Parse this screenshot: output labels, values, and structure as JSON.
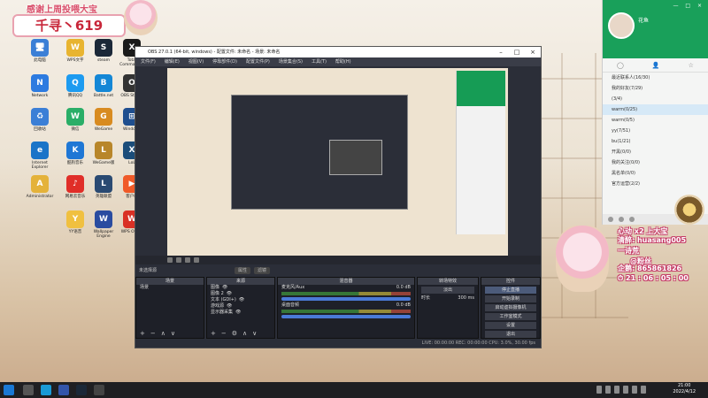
{
  "banner": {
    "title": "感谢上周投喂大宝",
    "name": "千寻丶619"
  },
  "desktop_icons": [
    {
      "label": "此电脑",
      "color": "#3b7fd6",
      "glyph": "🖥"
    },
    {
      "label": "WPS文字",
      "color": "#e8b430",
      "glyph": "W"
    },
    {
      "label": "steam",
      "color": "#1b2838",
      "glyph": "S"
    },
    {
      "label": "Total Commander",
      "color": "#1a1a1a",
      "glyph": "X"
    },
    {
      "label": "Network",
      "color": "#2d7be0",
      "glyph": "N"
    },
    {
      "label": "腾讯QQ",
      "color": "#1d9bf0",
      "glyph": "Q"
    },
    {
      "label": "Battle.net",
      "color": "#1487d6",
      "glyph": "B"
    },
    {
      "label": "OBS Studio",
      "color": "#333",
      "glyph": "O"
    },
    {
      "label": "回收站",
      "color": "#3b7fd6",
      "glyph": "♻"
    },
    {
      "label": "微信",
      "color": "#2aae67",
      "glyph": "W"
    },
    {
      "label": "WeGame",
      "color": "#d88b20",
      "glyph": "G"
    },
    {
      "label": "Windows",
      "color": "#1f4f8f",
      "glyph": "⊞"
    },
    {
      "label": "Internet Explorer",
      "color": "#1a74c8",
      "glyph": "e"
    },
    {
      "label": "酷狗音乐",
      "color": "#1f77d5",
      "glyph": "K"
    },
    {
      "label": "WeGame版",
      "color": "#b8862a",
      "glyph": "L"
    },
    {
      "label": "LoL",
      "color": "#1b4d7a",
      "glyph": "X"
    },
    {
      "label": "Administrator",
      "color": "#e4b23a",
      "glyph": "A"
    },
    {
      "label": "网易云音乐",
      "color": "#e02e28",
      "glyph": "♪"
    },
    {
      "label": "英雄联盟",
      "color": "#2a4a72",
      "glyph": "L"
    },
    {
      "label": "客户端",
      "color": "#f05a28",
      "glyph": "▶"
    },
    {
      "label": "YY语音",
      "color": "#f0c040",
      "glyph": "Y"
    },
    {
      "label": "Wallpaper Engine",
      "color": "#2a4ca0",
      "glyph": "W"
    },
    {
      "label": "WPS Office",
      "color": "#d93025",
      "glyph": "W"
    }
  ],
  "obs": {
    "title": "OBS 27.0.1 (64-bit, windows) - 配置文件: 未命名 - 场景: 未命名",
    "menu": [
      "文件(F)",
      "编辑(E)",
      "视图(V)",
      "停靠部件(D)",
      "配置文件(P)",
      "场景集合(S)",
      "工具(T)",
      "帮助(H)"
    ],
    "source_bar": "未选择源",
    "source_btns": [
      "属性",
      "滤镜"
    ],
    "docks": {
      "scenes": {
        "title": "场景",
        "items": [
          "场景"
        ]
      },
      "sources": {
        "title": "来源",
        "items": [
          "图像",
          "图像 2",
          "文本 (GDI+)",
          "游戏源",
          "显示器采集"
        ]
      },
      "mixer": {
        "title": "混音器",
        "channels": [
          {
            "name": "麦克风/Aux",
            "db": "0.0 dB"
          },
          {
            "name": "桌面音频",
            "db": "0.0 dB"
          }
        ]
      },
      "transitions": {
        "title": "转场特效",
        "type": "淡出",
        "duration_label": "时长",
        "duration": "300 ms"
      },
      "controls": {
        "title": "控件",
        "buttons": [
          "停止直播",
          "开始录制",
          "启动虚拟摄像机",
          "工作室模式",
          "设置",
          "退出"
        ]
      }
    },
    "status": "LIVE: 00:00:00   REC: 00:00:00   CPU: 3.0%, 30.00 fps"
  },
  "qq": {
    "name": "花鱼",
    "window_controls": "— □ ×",
    "groups": [
      "最近联系人(16/30)",
      "我的好友(7/29)",
      "(3/4)",
      "warm(0/25)",
      "warm(0/5)",
      "yy(7/51)",
      "bu(1/21)",
      "开黑(0/0)",
      "我的关注(0/0)",
      "黑名单(0/0)",
      "官方运营(2/2)"
    ],
    "selected_group": 3
  },
  "overlay": {
    "lines": [
      "心动 x2 上大宝",
      "清醉: huasang005",
      "一诗荒",
      "@粉丝",
      "企鹅: 865861826",
      "⏱ 21 : 06 : 05 : 00"
    ]
  },
  "taskbar": {
    "time": "21:00",
    "date": "2022/4/12"
  }
}
